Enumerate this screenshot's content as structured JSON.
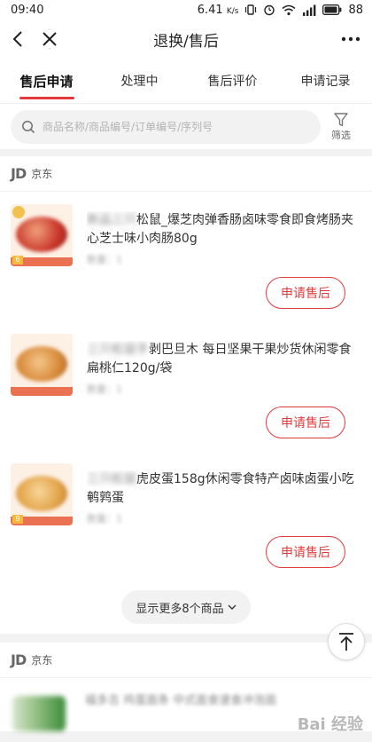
{
  "status_bar": {
    "time": "09:40",
    "speed": "6.41",
    "speed_unit": "K/s",
    "battery": "88"
  },
  "nav": {
    "title": "退换/售后",
    "icons": [
      "back-icon",
      "close-icon",
      "more-icon"
    ]
  },
  "tabs": [
    {
      "label": "售后申请",
      "active": true
    },
    {
      "label": "处理中",
      "active": false
    },
    {
      "label": "售后评价",
      "active": false
    },
    {
      "label": "申请记录",
      "active": false
    }
  ],
  "search": {
    "placeholder": "商品名称/商品编号/订单编号/序列号",
    "filter_label": "筛选"
  },
  "stores": [
    {
      "logo": "JD",
      "name": "京东",
      "items": [
        {
          "title_prefix": "新品三只",
          "title": "松鼠_爆芝肉弹香肠卤味零食即食烤肠夹心芝士味小肉肠80g",
          "qty": "数量：1",
          "badge": "6",
          "action": "申请售后"
        },
        {
          "title_prefix": "三只松鼠手",
          "title": "剥巴旦木 每日坚果干果炒货休闲零食扁桃仁120g/袋",
          "qty": "数量：1",
          "badge": "",
          "action": "申请售后"
        },
        {
          "title_prefix": "三只松鼠",
          "title": "虎皮蛋158g休闲零食特产卤味卤蛋小吃鹌鹑蛋",
          "qty": "数量：1",
          "badge": "9",
          "action": "申请售后"
        }
      ],
      "show_more": "显示更多8个商品"
    },
    {
      "logo": "JD",
      "name": "京东",
      "items": [
        {
          "title": "福多吉 鸡蛋面条 中式面食速食冲泡面"
        }
      ]
    }
  ],
  "watermark": "Bai 经验",
  "colors": {
    "accent": "#e4393c",
    "background": "#f2f2f2"
  }
}
